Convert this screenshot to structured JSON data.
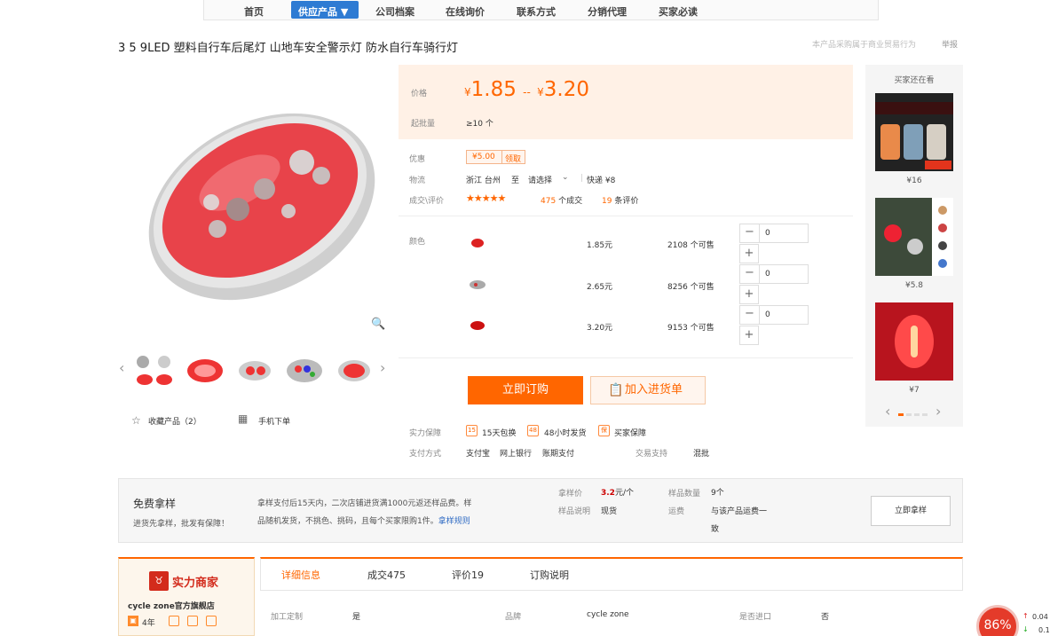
{
  "nav": {
    "items": [
      "首页",
      "公司档案",
      "在线询价",
      "联系方式",
      "分销代理",
      "买家必读"
    ],
    "active": "供应产品 ▼"
  },
  "product": {
    "title": "3 5 9LED 塑料自行车后尾灯 山地车安全警示灯 防水自行车骑行灯",
    "title_right": "本产品采购属于商业贸易行为",
    "report": "举报"
  },
  "gallery": {
    "prev": "‹",
    "next": "›",
    "favorite": "收藏产品（2）",
    "mobile": "手机下单"
  },
  "price": {
    "label": "价格",
    "currency": "¥",
    "low": "1.85",
    "sep": "--",
    "high": "3.20",
    "moq_label": "起批量",
    "moq": "≥10 个"
  },
  "promo": {
    "label": "优惠",
    "coupon_value": "¥5.00",
    "coupon_action": "领取"
  },
  "logistics": {
    "label": "物流",
    "from": "浙江 台州",
    "to_label": "至",
    "to": "请选择",
    "express": "快递 ¥8"
  },
  "deal": {
    "label": "成交\\评价",
    "stars": "★★★★★",
    "count": "475",
    "count_unit": "个成交",
    "reviews": "19",
    "reviews_unit": "条评价"
  },
  "variants": {
    "label": "颜色",
    "rows": [
      {
        "price": "1.85元",
        "stock": "2108 个可售",
        "qty": "0"
      },
      {
        "price": "2.65元",
        "stock": "8256 个可售",
        "qty": "0"
      },
      {
        "price": "3.20元",
        "stock": "9153 个可售",
        "qty": "0"
      }
    ]
  },
  "actions": {
    "buy": "立即订购",
    "cart": "加入进货单"
  },
  "guarantee": {
    "label": "实力保障",
    "items": [
      "15天包换",
      "48小时发货",
      "买家保障"
    ],
    "icons": [
      "15",
      "48",
      "保"
    ]
  },
  "payment": {
    "label": "支付方式",
    "methods": [
      "支付宝",
      "网上银行",
      "账期支付"
    ],
    "trade_label": "交易支持",
    "trade": "混批"
  },
  "side": {
    "title": "买家还在看",
    "prices": [
      "¥16",
      "¥5.8",
      "¥7"
    ],
    "prev": "‹",
    "next": "›"
  },
  "sample": {
    "title": "免费拿样",
    "subtitle": "进货先拿样，批发有保障！",
    "desc_line1": "拿样支付后15天内，二次店铺进货满1000元返还样品费。样",
    "desc_line2": "品随机发货，不挑色、挑码，且每个买家限购1件。",
    "rules": "拿样规则",
    "price_label": "拿样价",
    "price": "3.2",
    "price_unit": "元/个",
    "qty_label": "样品数量",
    "qty": "9个",
    "note_label": "样品说明",
    "note": "现货",
    "freight_label": "运费",
    "freight_line1": "与该产品运费一",
    "freight_line2": "致",
    "button": "立即拿样"
  },
  "shop": {
    "badge": "实力商家",
    "name": "cycle zone官方旗舰店",
    "years": "4年"
  },
  "tabs": [
    "详细信息",
    "成交475",
    "评价19",
    "订购说明"
  ],
  "attrs": [
    {
      "k": "加工定制",
      "v": "是"
    },
    {
      "k": "品牌",
      "v": "cycle zone"
    },
    {
      "k": "是否进口",
      "v": "否"
    }
  ],
  "float": {
    "percent": "86%",
    "up": "0.04",
    "down": "0.1"
  }
}
